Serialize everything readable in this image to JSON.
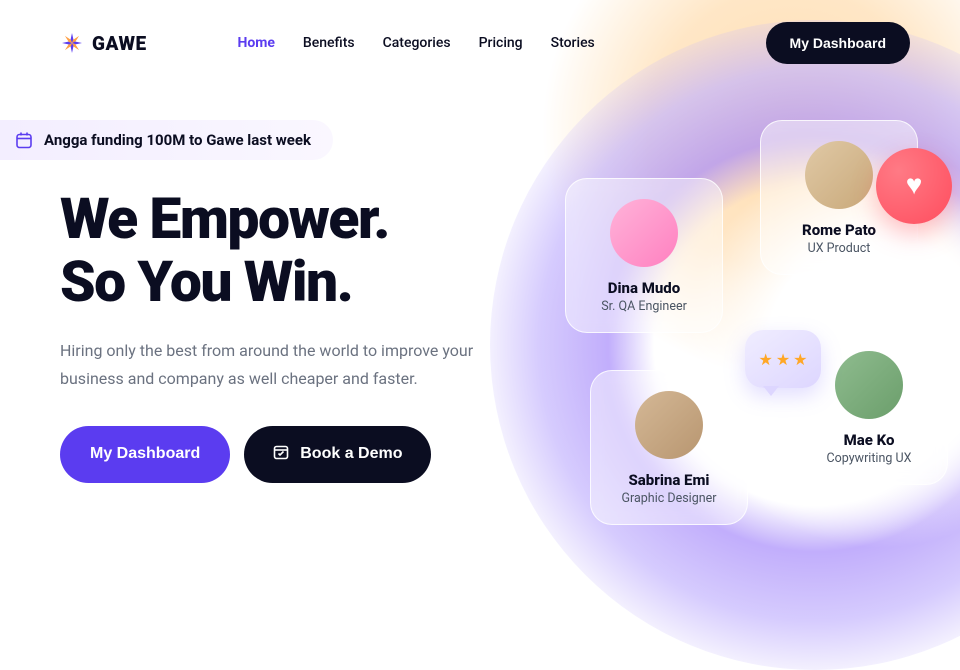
{
  "brand": {
    "name": "GAWE"
  },
  "nav": {
    "items": [
      {
        "label": "Home",
        "active": true
      },
      {
        "label": "Benefits",
        "active": false
      },
      {
        "label": "Categories",
        "active": false
      },
      {
        "label": "Pricing",
        "active": false
      },
      {
        "label": "Stories",
        "active": false
      }
    ],
    "dashboard_label": "My Dashboard"
  },
  "banner": {
    "text": "Angga funding 100M to Gawe last week"
  },
  "hero": {
    "title_line1": "We Empower.",
    "title_line2": "So You Win.",
    "subhead": "Hiring only the best from around the world to improve your business and company as well cheaper and faster.",
    "cta_primary": "My Dashboard",
    "cta_secondary": "Book a Demo"
  },
  "people": [
    {
      "name": "Dina Mudo",
      "role": "Sr. QA Engineer"
    },
    {
      "name": "Rome Pato",
      "role": "UX Product"
    },
    {
      "name": "Sabrina Emi",
      "role": "Graphic Designer"
    },
    {
      "name": "Mae Ko",
      "role": "Copywriting UX"
    }
  ],
  "colors": {
    "primary": "#5b3cf0",
    "dark": "#0b0d21"
  }
}
